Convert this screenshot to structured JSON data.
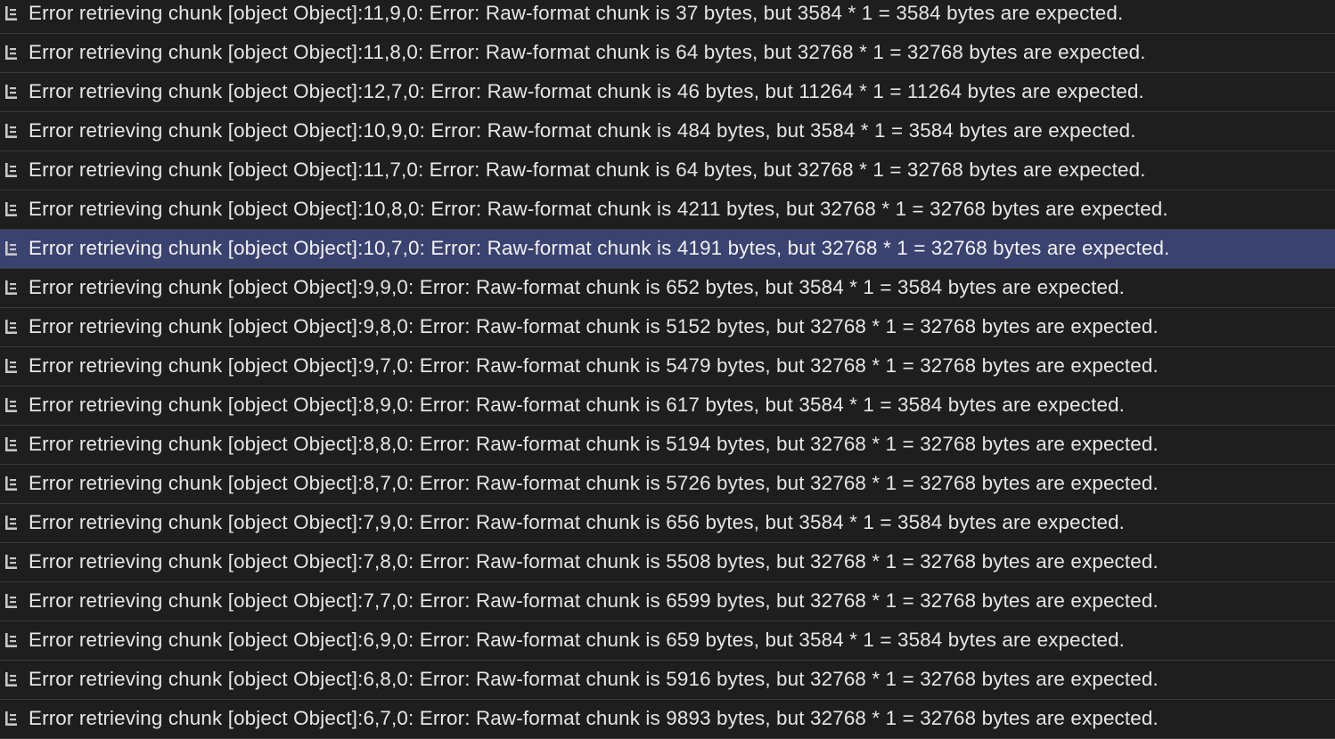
{
  "console": {
    "messages": [
      {
        "text": "Error retrieving chunk [object Object]:11,9,0: Error: Raw-format chunk is 37 bytes, but 3584 * 1 = 3584 bytes are expected.",
        "icon": "log-group-icon",
        "selected": false
      },
      {
        "text": "Error retrieving chunk [object Object]:11,8,0: Error: Raw-format chunk is 64 bytes, but 32768 * 1 = 32768 bytes are expected.",
        "icon": "log-group-icon",
        "selected": false
      },
      {
        "text": "Error retrieving chunk [object Object]:12,7,0: Error: Raw-format chunk is 46 bytes, but 11264 * 1 = 11264 bytes are expected.",
        "icon": "log-group-icon",
        "selected": false
      },
      {
        "text": "Error retrieving chunk [object Object]:10,9,0: Error: Raw-format chunk is 484 bytes, but 3584 * 1 = 3584 bytes are expected.",
        "icon": "log-group-icon",
        "selected": false
      },
      {
        "text": "Error retrieving chunk [object Object]:11,7,0: Error: Raw-format chunk is 64 bytes, but 32768 * 1 = 32768 bytes are expected.",
        "icon": "log-group-icon",
        "selected": false
      },
      {
        "text": "Error retrieving chunk [object Object]:10,8,0: Error: Raw-format chunk is 4211 bytes, but 32768 * 1 = 32768 bytes are expected.",
        "icon": "log-group-icon",
        "selected": false
      },
      {
        "text": "Error retrieving chunk [object Object]:10,7,0: Error: Raw-format chunk is 4191 bytes, but 32768 * 1 = 32768 bytes are expected.",
        "icon": "log-group-icon",
        "selected": true
      },
      {
        "text": "Error retrieving chunk [object Object]:9,9,0: Error: Raw-format chunk is 652 bytes, but 3584 * 1 = 3584 bytes are expected.",
        "icon": "log-group-icon",
        "selected": false
      },
      {
        "text": "Error retrieving chunk [object Object]:9,8,0: Error: Raw-format chunk is 5152 bytes, but 32768 * 1 = 32768 bytes are expected.",
        "icon": "log-group-icon",
        "selected": false
      },
      {
        "text": "Error retrieving chunk [object Object]:9,7,0: Error: Raw-format chunk is 5479 bytes, but 32768 * 1 = 32768 bytes are expected.",
        "icon": "log-group-icon",
        "selected": false
      },
      {
        "text": "Error retrieving chunk [object Object]:8,9,0: Error: Raw-format chunk is 617 bytes, but 3584 * 1 = 3584 bytes are expected.",
        "icon": "log-group-icon",
        "selected": false
      },
      {
        "text": "Error retrieving chunk [object Object]:8,8,0: Error: Raw-format chunk is 5194 bytes, but 32768 * 1 = 32768 bytes are expected.",
        "icon": "log-group-icon",
        "selected": false
      },
      {
        "text": "Error retrieving chunk [object Object]:8,7,0: Error: Raw-format chunk is 5726 bytes, but 32768 * 1 = 32768 bytes are expected.",
        "icon": "log-group-icon",
        "selected": false
      },
      {
        "text": "Error retrieving chunk [object Object]:7,9,0: Error: Raw-format chunk is 656 bytes, but 3584 * 1 = 3584 bytes are expected.",
        "icon": "log-group-icon",
        "selected": false
      },
      {
        "text": "Error retrieving chunk [object Object]:7,8,0: Error: Raw-format chunk is 5508 bytes, but 32768 * 1 = 32768 bytes are expected.",
        "icon": "log-group-icon",
        "selected": false
      },
      {
        "text": "Error retrieving chunk [object Object]:7,7,0: Error: Raw-format chunk is 6599 bytes, but 32768 * 1 = 32768 bytes are expected.",
        "icon": "log-group-icon",
        "selected": false
      },
      {
        "text": "Error retrieving chunk [object Object]:6,9,0: Error: Raw-format chunk is 659 bytes, but 3584 * 1 = 3584 bytes are expected.",
        "icon": "log-group-icon",
        "selected": false
      },
      {
        "text": "Error retrieving chunk [object Object]:6,8,0: Error: Raw-format chunk is 5916 bytes, but 32768 * 1 = 32768 bytes are expected.",
        "icon": "log-group-icon",
        "selected": false
      },
      {
        "text": "Error retrieving chunk [object Object]:6,7,0: Error: Raw-format chunk is 9893 bytes, but 32768 * 1 = 32768 bytes are expected.",
        "icon": "log-group-icon",
        "selected": false
      }
    ]
  },
  "colors": {
    "background": "#1e1e1e",
    "row_divider": "#3a3a3a",
    "selected_row": "#3a4270",
    "text": "#e6e6e6",
    "icon": "#c8c8c8"
  }
}
